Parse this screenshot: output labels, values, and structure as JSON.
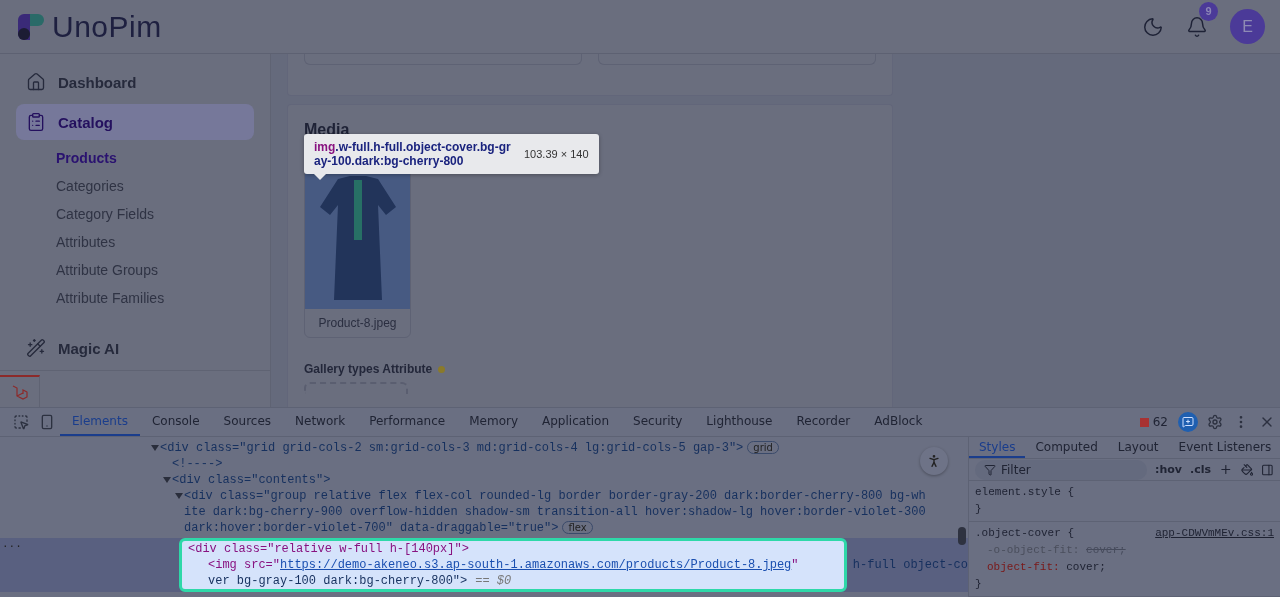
{
  "header": {
    "logo_text": "UnoPim",
    "notification_count": "9",
    "avatar_initial": "E"
  },
  "sidebar": {
    "items": [
      {
        "kind": "home",
        "label": "Dashboard",
        "selected": false
      },
      {
        "kind": "clipboard",
        "label": "Catalog",
        "selected": true,
        "children": [
          {
            "label": "Products",
            "selected": true
          },
          {
            "label": "Categories",
            "selected": false
          },
          {
            "label": "Category Fields",
            "selected": false
          },
          {
            "label": "Attributes",
            "selected": false
          },
          {
            "label": "Attribute Groups",
            "selected": false
          },
          {
            "label": "Attribute Families",
            "selected": false
          }
        ]
      },
      {
        "kind": "wand",
        "label": "Magic AI",
        "selected": false
      }
    ]
  },
  "main": {
    "media_title": "Media",
    "image_caption": "Product-8.jpeg",
    "gallery_label": "Gallery types Attribute",
    "inspect_tooltip": {
      "tag": "img",
      "classes": ".w-full.h-full.object-cover.bg-gray-100.dark:bg-cherry-800",
      "size": "103.39 × 140"
    }
  },
  "devtools": {
    "tabs": [
      {
        "label": "Elements",
        "selected": true
      },
      {
        "label": "Console",
        "selected": false
      },
      {
        "label": "Sources",
        "selected": false
      },
      {
        "label": "Network",
        "selected": false
      },
      {
        "label": "Performance",
        "selected": false
      },
      {
        "label": "Memory",
        "selected": false
      },
      {
        "label": "Application",
        "selected": false
      },
      {
        "label": "Security",
        "selected": false
      },
      {
        "label": "Lighthouse",
        "selected": false
      },
      {
        "label": "Recorder",
        "selected": false
      },
      {
        "label": "AdBlock",
        "selected": false
      }
    ],
    "issue_count": "62",
    "nodes": [
      {
        "expanded": true,
        "text": "<div class=\"grid grid-cols-2 sm:grid-cols-3 md:grid-cols-4 lg:grid-cols-5 gap-3\">",
        "badge": "grid",
        "children": [
          {
            "text": "<!---->"
          },
          {
            "expanded": true,
            "text": "<div class=\"contents\">",
            "children": [
              {
                "expanded": true,
                "text": "<div class=\"group relative flex flex-col rounded-lg border border-gray-200 dark:border-cherry-800 bg-white dark:bg-cherry-900 overflow-hidden shadow-sm transition-all hover:shadow-lg hover:border-violet-300 dark:hover:border-violet-700\" data-draggable=\"true\">",
                "badge": "flex"
              }
            ]
          }
        ]
      }
    ],
    "row_menu": "···",
    "selected_node": {
      "parent_text": "<div class=\"relative w-full h-[140px]\">",
      "img_open": "<img src=\"",
      "url": "https://demo-akeneo.s3.ap-south-1.amazonaws.com/products/Product-8.jpeg",
      "img_close": "\"",
      "side_text": "h-full object-co",
      "continuation": "ver bg-gray-100 dark:bg-cherry-800\">",
      "marker": "== $0"
    },
    "styles_tabs": [
      {
        "label": "Styles",
        "selected": true
      },
      {
        "label": "Computed",
        "selected": false
      },
      {
        "label": "Layout",
        "selected": false
      },
      {
        "label": "Event Listeners",
        "selected": false
      }
    ],
    "filter_placeholder": "Filter",
    "hov": ":hov",
    "cls": ".cls",
    "rules": [
      {
        "selector": "element.style {",
        "close": "}"
      },
      {
        "selector": ".object-cover {",
        "source": "app-CDWVmMEv.css:1",
        "props": [
          {
            "name": "-o-object-fit:",
            "value": "cover;",
            "overridden": true
          },
          {
            "name": "object-fit:",
            "value": "cover;",
            "overridden": false
          }
        ],
        "close": "}"
      }
    ]
  }
}
